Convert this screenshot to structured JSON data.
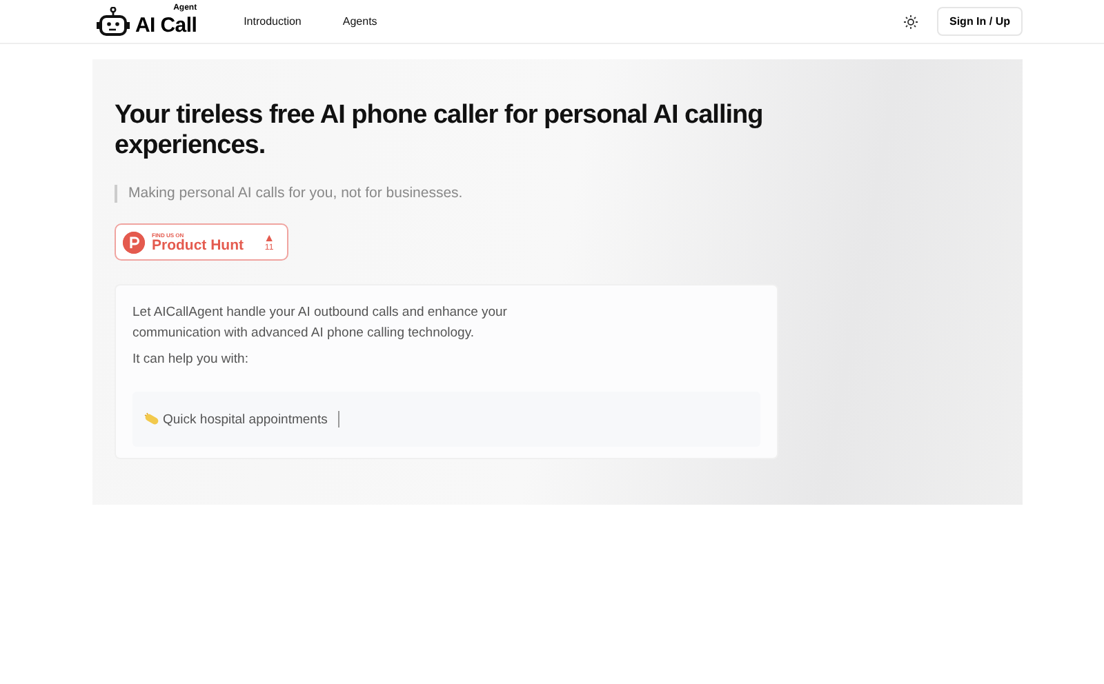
{
  "header": {
    "logo": {
      "badge": "Agent",
      "name": "AI Call"
    },
    "nav": [
      "Introduction",
      "Agents"
    ],
    "sign_in": "Sign In / Up"
  },
  "hero": {
    "title": "Your tireless free AI phone caller for personal AI calling experiences.",
    "tagline": "Making personal AI calls for you, not for businesses.",
    "product_hunt": {
      "caption": "FIND US ON",
      "name": "Product Hunt",
      "arrow": "▲",
      "votes": "11"
    },
    "card": {
      "intro": "Let AICallAgent handle your AI outbound calls and enhance your communication with advanced AI phone calling technology.",
      "lead": "It can help you with:",
      "typing": "Quick hospital appointments"
    }
  }
}
